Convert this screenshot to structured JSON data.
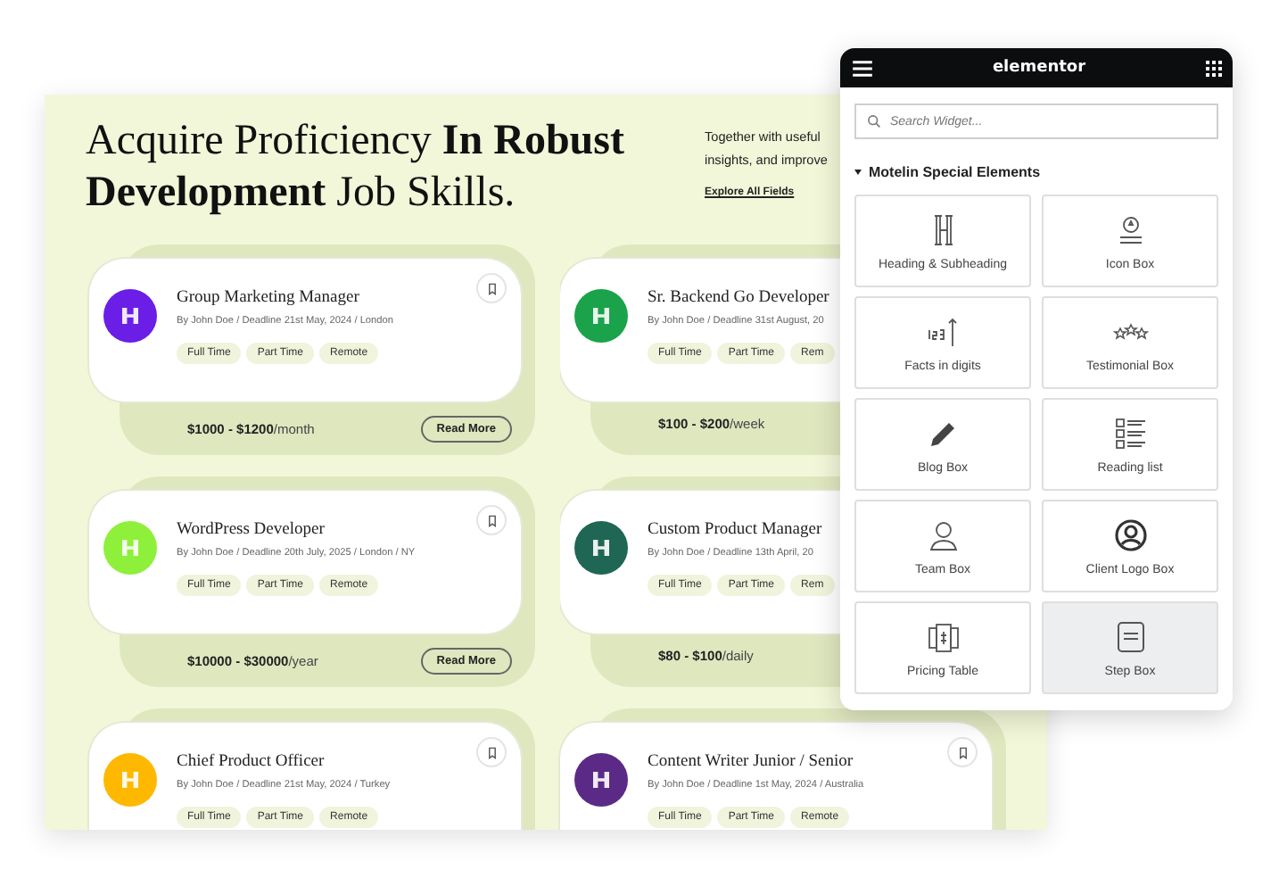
{
  "page": {
    "heading": "Acquire Proficiency **In Robust Development** Job Skills.",
    "intro_lines": [
      "Together with useful",
      "insights, and improve"
    ],
    "explore_link": "Explore All Fields"
  },
  "jobs": [
    {
      "title": "Group Marketing Manager",
      "meta": "By John Doe / Deadline 21st May, 2024 / London",
      "tags": [
        "Full Time",
        "Part Time",
        "Remote"
      ],
      "salary": "$1000 - $1200",
      "period": "/month",
      "button": "Read More",
      "color": "#6a1ee6"
    },
    {
      "title": "Sr. Backend Go Developer",
      "meta": "By John Doe / Deadline 31st August, 20",
      "tags": [
        "Full Time",
        "Part Time",
        "Rem"
      ],
      "salary": "$100 - $200",
      "period": "/week",
      "color": "#1aa34a"
    },
    {
      "title": "WordPress Developer",
      "meta": "By John Doe / Deadline 20th July, 2025 / London / NY",
      "tags": [
        "Full Time",
        "Part Time",
        "Remote"
      ],
      "salary": "$10000 - $30000",
      "period": "/year",
      "button": "Read More",
      "color": "#8ef03a"
    },
    {
      "title": "Custom Product Manager",
      "meta": "By John Doe / Deadline 13th April, 20",
      "tags": [
        "Full Time",
        "Part Time",
        "Rem"
      ],
      "salary": "$80 - $100",
      "period": "/daily",
      "color": "#1f6654"
    },
    {
      "title": "Chief Product Officer",
      "meta": "By John Doe / Deadline 21st May, 2024 / Turkey",
      "tags": [
        "Full Time",
        "Part Time",
        "Remote"
      ],
      "color": "#ffb800"
    },
    {
      "title": "Content Writer Junior / Senior",
      "meta": "By John Doe / Deadline 1st May, 2024 / Australia",
      "tags": [
        "Full Time",
        "Part Time",
        "Remote"
      ],
      "color": "#5b2a86"
    }
  ],
  "panel": {
    "brand": "elementor",
    "search": {
      "placeholder": "Search Widget..."
    },
    "section": {
      "title": "Motelin Special Elements",
      "expanded": true
    },
    "widgets": [
      {
        "kind": "heading",
        "label": "Heading & Subheading",
        "selected": false
      },
      {
        "kind": "iconbox",
        "label": "Icon Box",
        "selected": false
      },
      {
        "kind": "facts",
        "label": "Facts in digits",
        "selected": false
      },
      {
        "kind": "stars",
        "label": "Testimonial Box",
        "selected": false
      },
      {
        "kind": "pencil",
        "label": "Blog Box",
        "selected": false
      },
      {
        "kind": "list",
        "label": "Reading list",
        "selected": false
      },
      {
        "kind": "person",
        "label": "Team Box",
        "selected": false
      },
      {
        "kind": "user",
        "label": "Client Logo Box",
        "selected": false
      },
      {
        "kind": "pricing",
        "label": "Pricing Table",
        "selected": false
      },
      {
        "kind": "step",
        "label": "Step Box",
        "selected": true
      }
    ]
  }
}
